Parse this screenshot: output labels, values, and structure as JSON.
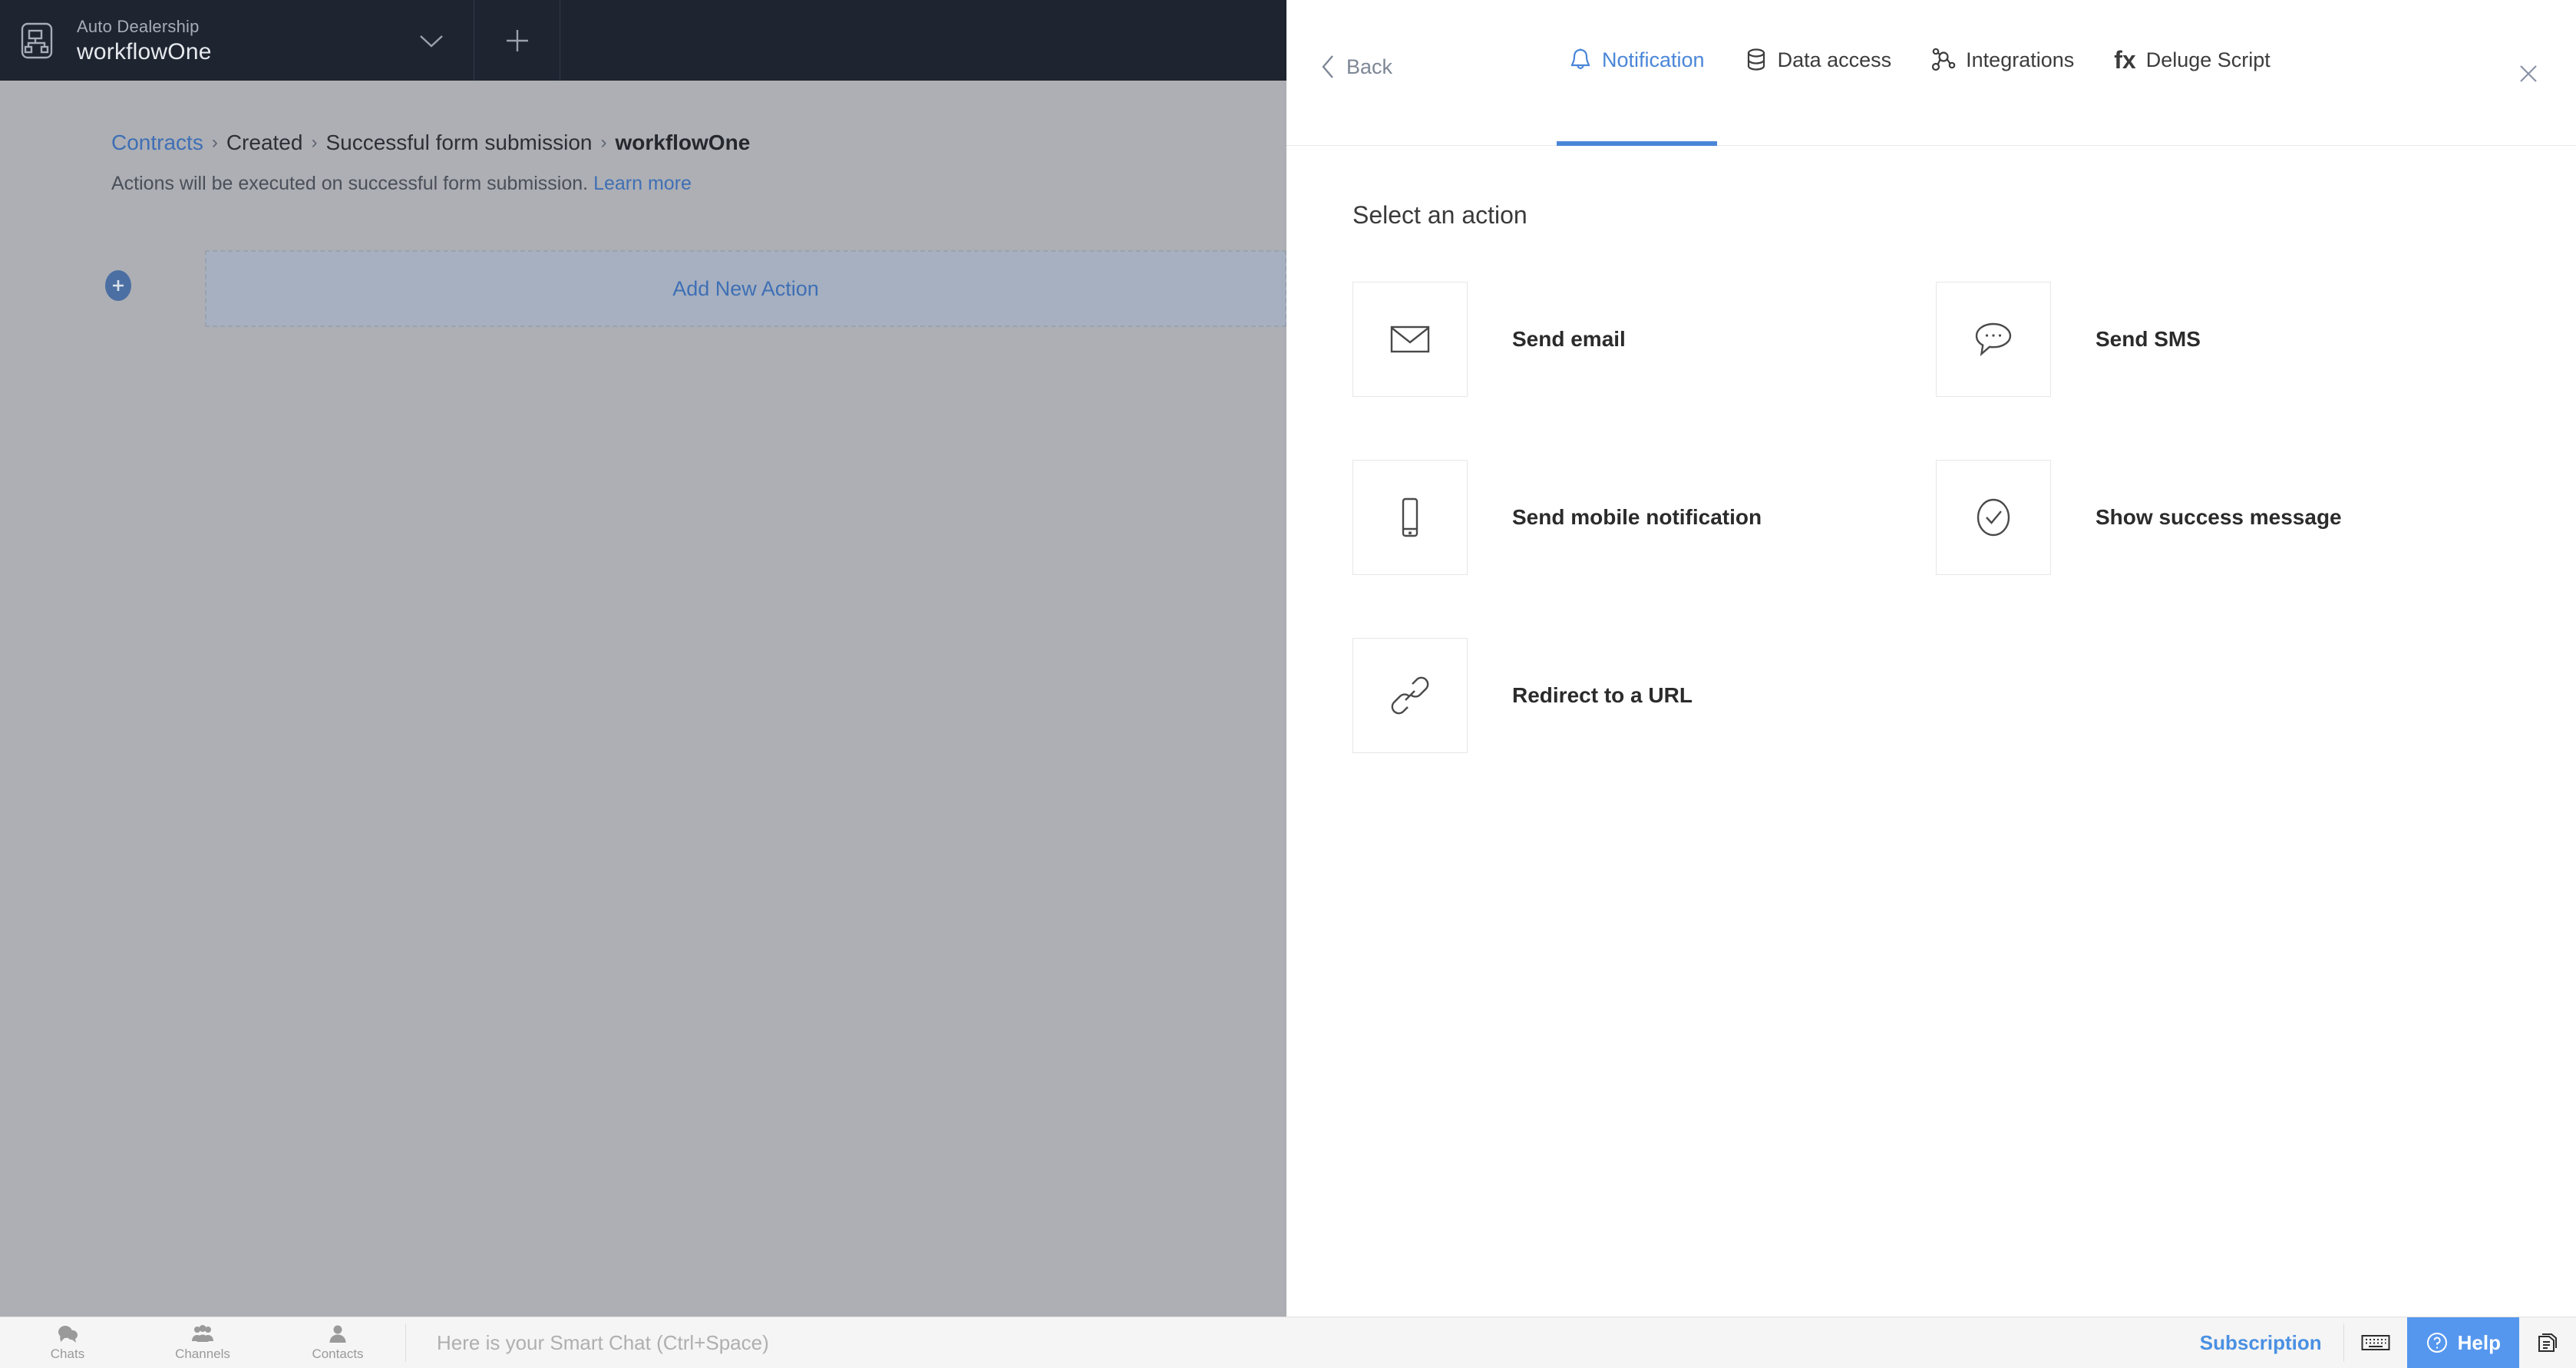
{
  "header": {
    "app_icon": "workflow-icon",
    "org_name": "Auto Dealership",
    "workflow_name": "workflowOne",
    "chevron_icon": "chevron-down-icon",
    "add_icon": "plus-icon"
  },
  "breadcrumb": {
    "items": [
      {
        "label": "Contracts",
        "type": "link"
      },
      {
        "label": "Created",
        "type": "text"
      },
      {
        "label": "Successful form submission",
        "type": "text"
      },
      {
        "label": "workflowOne",
        "type": "current"
      }
    ],
    "separator": "›"
  },
  "subnote": {
    "text": "Actions will be executed on successful form submission.",
    "link_label": "Learn more"
  },
  "canvas": {
    "add_action_label": "Add New Action",
    "add_circle_icon": "plus-circle-icon"
  },
  "panel": {
    "back_label": "Back",
    "back_icon": "chevron-left-icon",
    "close_icon": "close-icon",
    "active_tab": "Notification",
    "accent_color": "#4A86D8",
    "tabs": [
      {
        "label": "Notification",
        "icon": "bell-icon",
        "active": true
      },
      {
        "label": "Data access",
        "icon": "database-icon",
        "active": false
      },
      {
        "label": "Integrations",
        "icon": "nodes-icon",
        "active": false
      },
      {
        "label": "Deluge Script",
        "icon": "fx-icon",
        "active": false
      }
    ],
    "section_title": "Select an action",
    "actions": [
      {
        "label": "Send email",
        "icon": "envelope-icon"
      },
      {
        "label": "Send SMS",
        "icon": "chat-bubble-icon"
      },
      {
        "label": "Send mobile notification",
        "icon": "mobile-icon"
      },
      {
        "label": "Show success message",
        "icon": "check-circle-icon"
      },
      {
        "label": "Redirect to a URL",
        "icon": "link-icon"
      }
    ]
  },
  "taskbar": {
    "items": [
      {
        "label": "Chats",
        "icon": "chats-icon"
      },
      {
        "label": "Channels",
        "icon": "channels-icon"
      },
      {
        "label": "Contacts",
        "icon": "contacts-icon"
      }
    ],
    "chat_placeholder": "Here is your Smart Chat (Ctrl+Space)",
    "subscription_label": "Subscription",
    "keyboard_icon": "keyboard-icon",
    "help_label": "Help",
    "help_icon": "question-circle-icon",
    "copy_icon": "documents-icon",
    "help_bg_color": "#5597EE",
    "subscription_color": "#4A90E2"
  }
}
